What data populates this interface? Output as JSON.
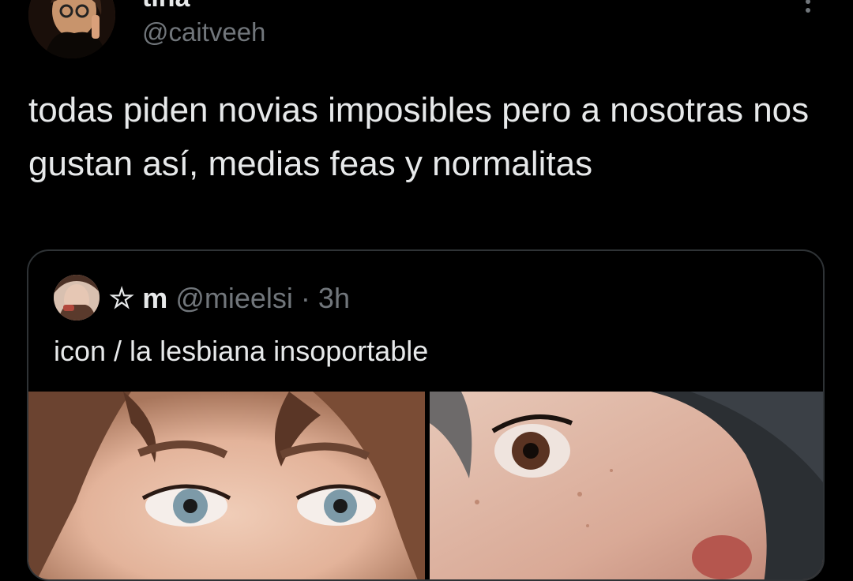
{
  "tweet": {
    "author": {
      "display_name": "tina",
      "handle": "@caitveeh"
    },
    "text": "todas piden novias imposibles pero a nosotras nos gustan así, medias feas y normalitas",
    "more_icon": "more-vertical-icon"
  },
  "quoted_tweet": {
    "author": {
      "display_name": "☆ m",
      "handle": "@mieelsi",
      "separator": "·",
      "time": "3h"
    },
    "text": "icon / la lesbiana insoportable"
  },
  "colors": {
    "background": "#000000",
    "primary_text": "#e7e9ea",
    "secondary_text": "#71767b",
    "border": "#2f3336"
  }
}
